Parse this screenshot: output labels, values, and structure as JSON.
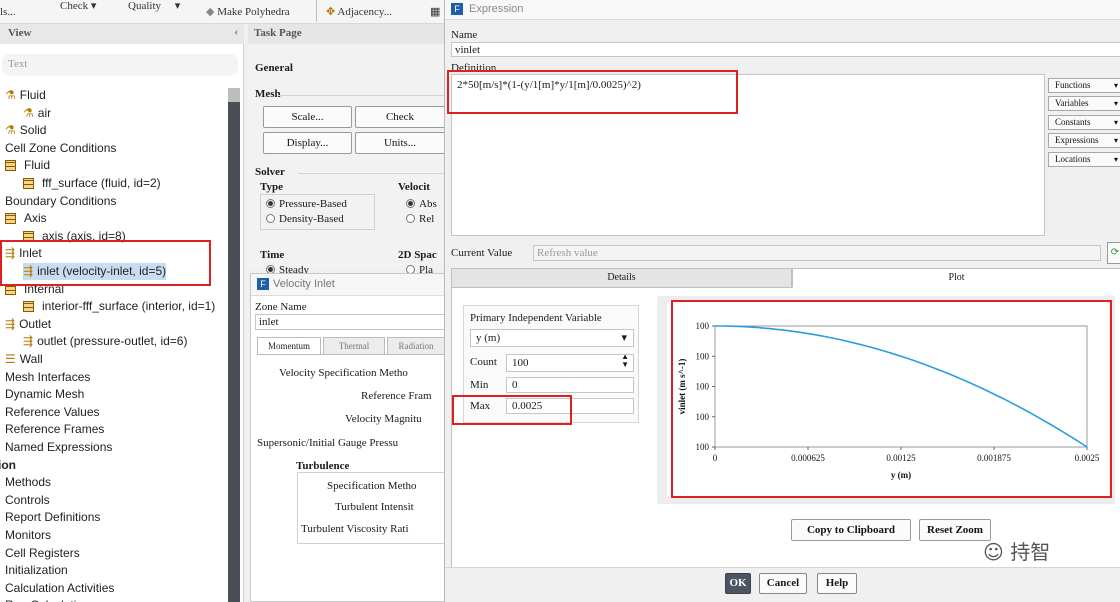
{
  "toolbar": {
    "items": [
      "ls...",
      "Check",
      "Quality",
      "Make Polyhedra",
      "Adjacency..."
    ]
  },
  "tree": {
    "header": "View",
    "filter_placeholder": "Text",
    "rows": [
      {
        "label": "Fluid",
        "indent": 1,
        "icon": "fluid-material-icon"
      },
      {
        "label": "air",
        "indent": 2,
        "icon": "fluid-material-icon"
      },
      {
        "label": "Solid",
        "indent": 1,
        "icon": "solid-material-icon"
      },
      {
        "label": "Cell Zone Conditions",
        "indent": 0,
        "icon": ""
      },
      {
        "label": "Fluid",
        "indent": 1,
        "icon": "grid-icon"
      },
      {
        "label": "fff_surface (fluid, id=2)",
        "indent": 2,
        "icon": "grid-icon"
      },
      {
        "label": "Boundary Conditions",
        "indent": 0,
        "icon": ""
      },
      {
        "label": "Axis",
        "indent": 1,
        "icon": "grid-icon"
      },
      {
        "label": "axis (axis, id=8)",
        "indent": 2,
        "icon": "grid-icon"
      },
      {
        "label": "Inlet",
        "indent": 1,
        "icon": "inlet-icon"
      },
      {
        "label": "inlet (velocity-inlet, id=5)",
        "indent": 2,
        "icon": "inlet-icon"
      },
      {
        "label": "Internal",
        "indent": 1,
        "icon": "grid-icon"
      },
      {
        "label": "interior-fff_surface (interior, id=1)",
        "indent": 2,
        "icon": "grid-icon"
      },
      {
        "label": "Outlet",
        "indent": 1,
        "icon": "outlet-icon"
      },
      {
        "label": "outlet (pressure-outlet, id=6)",
        "indent": 2,
        "icon": "outlet-icon"
      },
      {
        "label": "Wall",
        "indent": 1,
        "icon": "wall-icon"
      },
      {
        "label": "Mesh Interfaces",
        "indent": 0,
        "icon": ""
      },
      {
        "label": "Dynamic Mesh",
        "indent": 0,
        "icon": ""
      },
      {
        "label": "Reference Values",
        "indent": 0,
        "icon": ""
      },
      {
        "label": "Reference Frames",
        "indent": 0,
        "icon": ""
      },
      {
        "label": "Named Expressions",
        "indent": 0,
        "icon": ""
      },
      {
        "label": "tion",
        "indent": -1,
        "icon": "",
        "bold": true
      },
      {
        "label": "Methods",
        "indent": 0,
        "icon": ""
      },
      {
        "label": "Controls",
        "indent": 0,
        "icon": ""
      },
      {
        "label": "Report Definitions",
        "indent": 0,
        "icon": ""
      },
      {
        "label": "Monitors",
        "indent": 0,
        "icon": ""
      },
      {
        "label": "Cell Registers",
        "indent": 0,
        "icon": ""
      },
      {
        "label": "Initialization",
        "indent": 0,
        "icon": ""
      },
      {
        "label": "Calculation Activities",
        "indent": 0,
        "icon": ""
      },
      {
        "label": "Run Calculation",
        "indent": 0,
        "icon": ""
      }
    ]
  },
  "task": {
    "header": "Task Page",
    "general": "General",
    "mesh": "Mesh",
    "scale": "Scale...",
    "check": "Check",
    "display": "Display...",
    "units": "Units...",
    "solver": "Solver",
    "type": "Type",
    "pressure_based": "Pressure-Based",
    "density_based": "Density-Based",
    "velocity": "Velocit",
    "abs": "Abs",
    "rel": "Rel",
    "time": "Time",
    "space2d": "2D Spac",
    "steady": "Steady",
    "planar": "Pla"
  },
  "velocity_inlet": {
    "title": "Velocity Inlet",
    "zone_name_label": "Zone Name",
    "zone_name": "inlet",
    "tabs": [
      "Momentum",
      "Thermal",
      "Radiation"
    ],
    "fields": [
      "Velocity Specification Metho",
      "Reference Fram",
      "Velocity Magnitu",
      "Supersonic/Initial Gauge Pressu"
    ],
    "turbulence": "Turbulence",
    "turb_fields": [
      "Specification Metho",
      "Turbulent Intensit",
      "Turbulent Viscosity Rati"
    ]
  },
  "expression": {
    "title": "Expression",
    "name_label": "Name",
    "name": "vinlet",
    "definition_label": "Definition",
    "definition": "2*50[m/s]*(1-(y/1[m]*y/1[m]/0.0025)^2)",
    "side_buttons": [
      "Functions",
      "Variables",
      "Constants",
      "Expressions",
      "Locations"
    ],
    "current_value_label": "Current Value",
    "current_value_placeholder": "Refresh value",
    "tabs": [
      "Details",
      "Plot"
    ],
    "primary_var_label": "Primary Independent Variable",
    "primary_var": "y (m)",
    "count_label": "Count",
    "count": "100",
    "min_label": "Min",
    "min": "0",
    "max_label": "Max",
    "max": "0.0025",
    "copy": "Copy to Clipboard",
    "reset_zoom": "Reset Zoom",
    "ok": "OK",
    "cancel": "Cancel",
    "help": "Help",
    "watermark": "持智"
  },
  "chart_data": {
    "type": "line",
    "title": "",
    "xlabel": "y (m)",
    "ylabel": "vinlet (m s^-1)",
    "xlim": [
      0,
      0.0025
    ],
    "x_ticks": [
      "0",
      "0.000625",
      "0.00125",
      "0.001875",
      "0.0025"
    ],
    "y_ticks": [
      "100",
      "100",
      "100",
      "100",
      "100"
    ],
    "series": [
      {
        "x": [
          0,
          0.00025,
          0.0005,
          0.00075,
          0.001,
          0.00125,
          0.0015,
          0.00175,
          0.002,
          0.00225,
          0.0025
        ],
        "values": [
          100,
          100,
          100,
          100,
          100,
          100,
          100,
          100,
          100,
          100,
          100
        ]
      }
    ],
    "color": "#2b9ee0"
  }
}
